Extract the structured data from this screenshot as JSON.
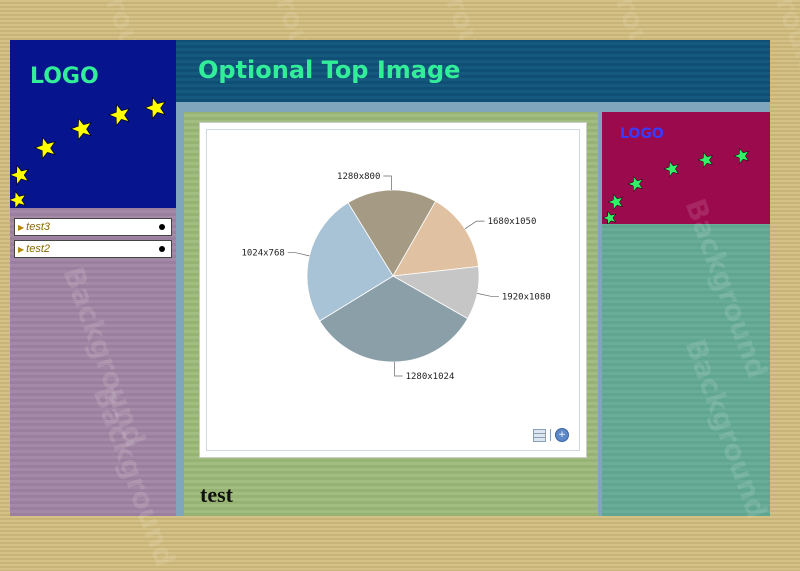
{
  "background": {
    "watermark_text": "Background"
  },
  "left_logo": {
    "text": "LOGO"
  },
  "nav": {
    "items": [
      {
        "label": "test3"
      },
      {
        "label": "test2"
      }
    ]
  },
  "header": {
    "title": "Optional Top Image"
  },
  "right_logo": {
    "text": "LOGO"
  },
  "content": {
    "heading": "test"
  },
  "colors": {
    "logo_text": "#33ee99",
    "left_logo_bg": "#06148e",
    "right_logo_bg": "#9b0a4d",
    "right_logo_text": "#3a3aff",
    "star": "#ffff00"
  },
  "chart_data": {
    "type": "pie",
    "categories": [
      "1280x800",
      "1680x1050",
      "1920x1080",
      "1280x1024",
      "1024x768"
    ],
    "values": [
      17,
      15,
      10,
      33,
      25
    ],
    "colors": [
      "#a59b85",
      "#e0c2a2",
      "#c6c6c6",
      "#8b9fa9",
      "#a9c3d6"
    ]
  }
}
